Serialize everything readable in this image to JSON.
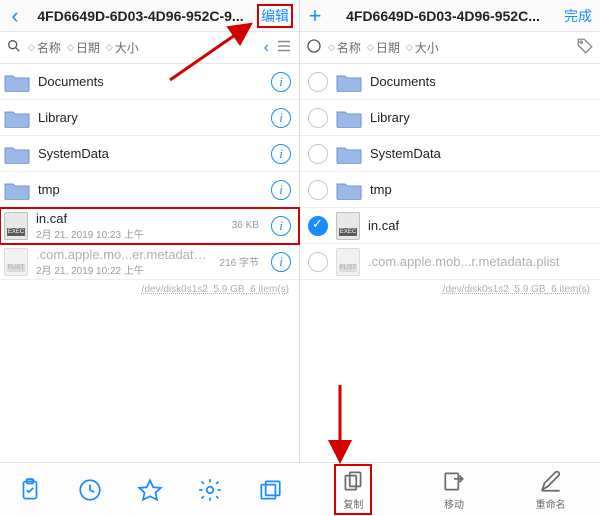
{
  "left": {
    "header": {
      "title": "4FD6649D-6D03-4D96-952C-9...",
      "edit": "编辑"
    },
    "sort": {
      "name": "名称",
      "date": "日期",
      "size": "大小"
    },
    "rows": [
      {
        "name": "Documents"
      },
      {
        "name": "Library"
      },
      {
        "name": "SystemData"
      },
      {
        "name": "tmp"
      },
      {
        "name": "in.caf",
        "sub": "2月 21, 2019 10:23 上午",
        "size": "36 KB"
      },
      {
        "name": ".com.apple.mo...er.metadata.plist",
        "sub": "2月 21, 2019 10:22 上午",
        "size": "216 字节"
      }
    ],
    "footer": {
      "dev": "/dev/disk0s1s2",
      "free": "5.9 GB",
      "count": "6 item(s)"
    }
  },
  "right": {
    "header": {
      "title": "4FD6649D-6D03-4D96-952C...",
      "done": "完成"
    },
    "sort": {
      "name": "名称",
      "date": "日期",
      "size": "大小"
    },
    "rows": [
      {
        "name": "Documents"
      },
      {
        "name": "Library"
      },
      {
        "name": "SystemData"
      },
      {
        "name": "tmp"
      },
      {
        "name": "in.caf"
      },
      {
        "name": ".com.apple.mob...r.metadata.plist"
      }
    ],
    "footer": {
      "dev": "/dev/disk0s1s2",
      "free": "5.9 GB",
      "count": "6 item(s)"
    }
  },
  "toolbar": {
    "copy": "复制",
    "move": "移动",
    "rename": "重命名"
  }
}
